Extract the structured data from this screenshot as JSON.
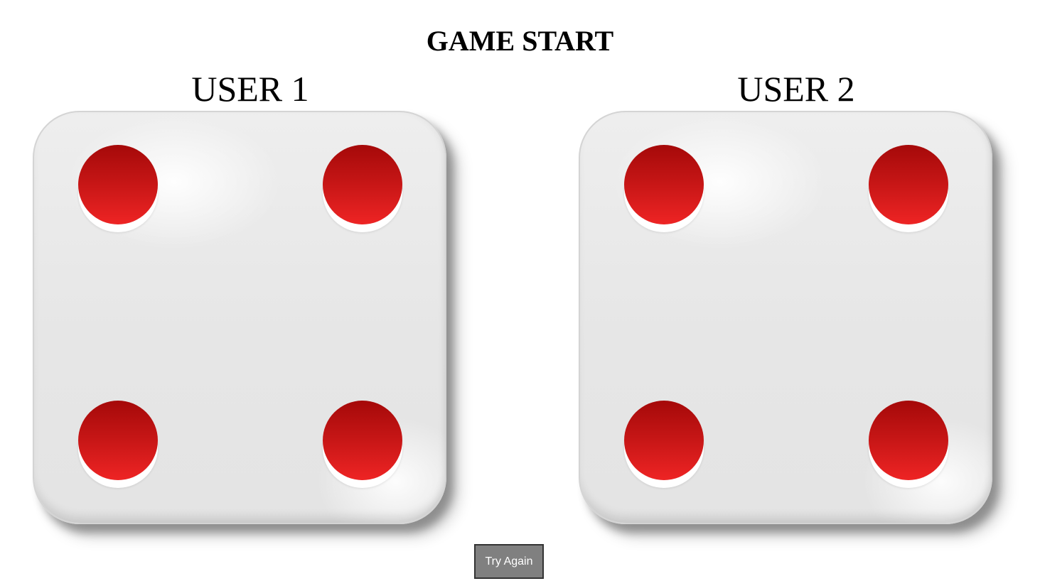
{
  "game": {
    "title": "GAME START",
    "pip_color": "#c41515",
    "die_face_color": "#e8e8e8"
  },
  "players": [
    {
      "label": "USER 1",
      "die_value": 4
    },
    {
      "label": "USER 2",
      "die_value": 4
    }
  ],
  "controls": {
    "try_again_label": "Try Again"
  }
}
